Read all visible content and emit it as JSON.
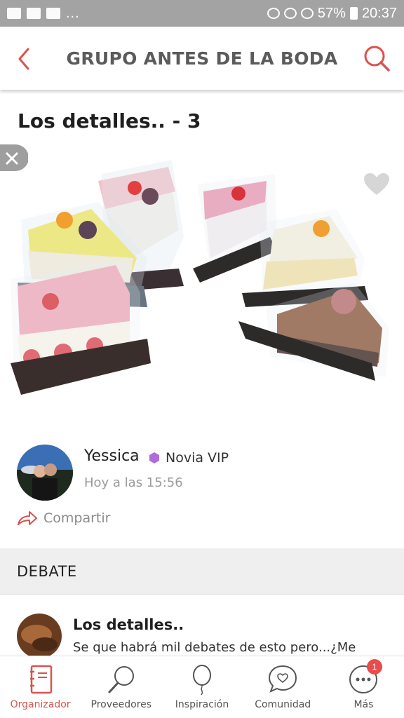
{
  "status_bar": {
    "battery": "57%",
    "time": "20:37",
    "overflow": "..."
  },
  "header": {
    "title": "GRUPO ANTES DE LA BODA",
    "accent": "#d9534f"
  },
  "post": {
    "title": "Los detalles.. - 3",
    "author": {
      "name": "Yessica",
      "badge": "Novia VIP",
      "badge_color": "#b06bd8",
      "time": "Hoy a las 15:56"
    },
    "share_label": "Compartir"
  },
  "debate": {
    "section_label": "DEBATE",
    "thread": {
      "title": "Los detalles..",
      "snippet": "Se que habrá mil debates de esto pero...¿Me"
    }
  },
  "nav": {
    "items": [
      {
        "label": "Organizador",
        "icon": "notebook-icon",
        "active": true
      },
      {
        "label": "Proveedores",
        "icon": "magnifier-icon",
        "active": false
      },
      {
        "label": "Inspiración",
        "icon": "balloon-icon",
        "active": false
      },
      {
        "label": "Comunidad",
        "icon": "chat-heart-icon",
        "active": false
      },
      {
        "label": "Más",
        "icon": "more-icon",
        "active": false,
        "badge": "1"
      }
    ]
  }
}
